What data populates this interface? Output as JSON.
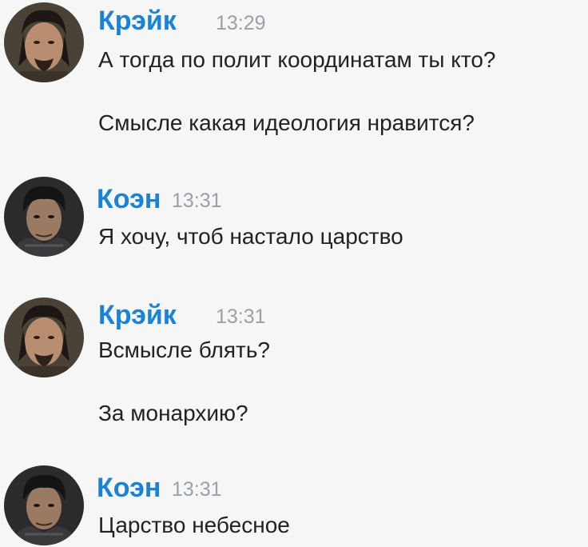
{
  "colors": {
    "background": "#f6f6f6",
    "name": "#1a83d6",
    "time": "#9aa0a6",
    "text": "#222222"
  },
  "messages": [
    {
      "author": "Крэйк",
      "avatar": "kreik-avatar-icon",
      "time": "13:29",
      "lines": [
        "А тогда по полит координатам ты кто?",
        "Смысле какая идеология нравится?"
      ]
    },
    {
      "author": "Коэн",
      "avatar": "koen-avatar-icon",
      "time": "13:31",
      "lines": [
        "Я хочу, чтоб настало царство"
      ]
    },
    {
      "author": "Крэйк",
      "avatar": "kreik-avatar-icon",
      "time": "13:31",
      "lines": [
        "Всмысле блять?",
        "За монархию?"
      ]
    },
    {
      "author": "Коэн",
      "avatar": "koen-avatar-icon",
      "time": "13:31",
      "lines": [
        "Царство небесное"
      ]
    }
  ]
}
